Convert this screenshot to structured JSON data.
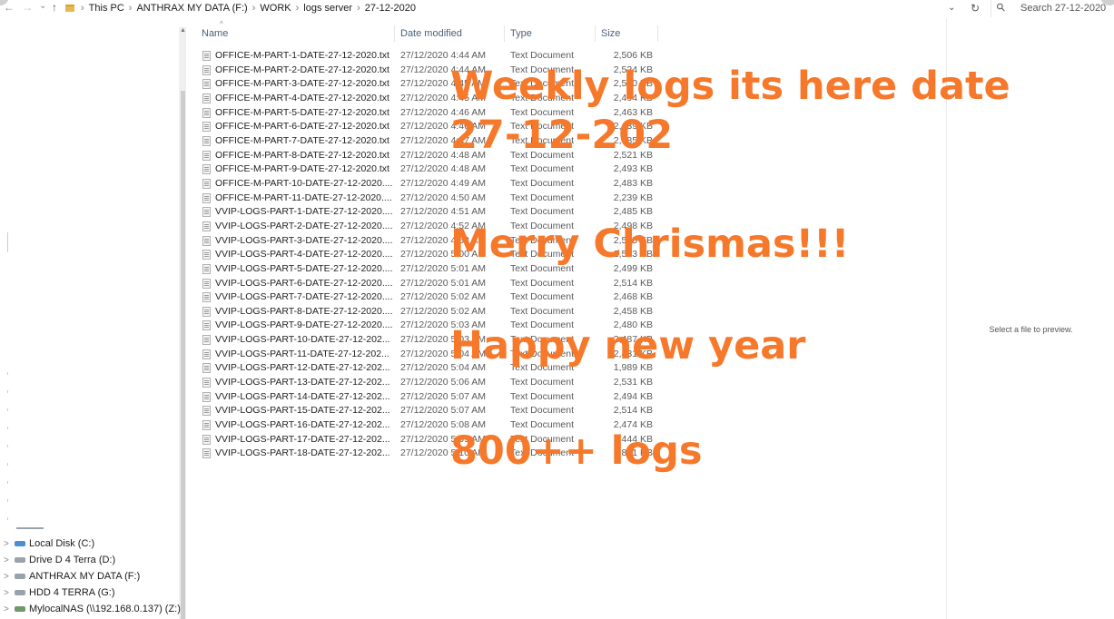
{
  "addressbar": {
    "back": "←",
    "forward": "→",
    "recent": "⌄",
    "up": "↑",
    "crumbs": [
      "This PC",
      "ANTHRAX MY DATA (F:)",
      "WORK",
      "logs server",
      "27-12-2020"
    ],
    "crumb_sep": "›",
    "dropdown": "⌄",
    "refresh": "↻",
    "search_placeholder": "Search 27-12-2020"
  },
  "headers": {
    "sort_indicator": "^",
    "name": "Name",
    "date": "Date modified",
    "type": "Type",
    "size": "Size"
  },
  "files": [
    {
      "name": "OFFICE-M-PART-1-DATE-27-12-2020.txt",
      "date": "27/12/2020 4:44 AM",
      "type": "Text Document",
      "size": "2,506 KB"
    },
    {
      "name": "OFFICE-M-PART-2-DATE-27-12-2020.txt",
      "date": "27/12/2020 4:44 AM",
      "type": "Text Document",
      "size": "2,524 KB"
    },
    {
      "name": "OFFICE-M-PART-3-DATE-27-12-2020.txt",
      "date": "27/12/2020 4:45 AM",
      "type": "Text Document",
      "size": "2,520 KB"
    },
    {
      "name": "OFFICE-M-PART-4-DATE-27-12-2020.txt",
      "date": "27/12/2020 4:45 AM",
      "type": "Text Document",
      "size": "2,494 KB"
    },
    {
      "name": "OFFICE-M-PART-5-DATE-27-12-2020.txt",
      "date": "27/12/2020 4:46 AM",
      "type": "Text Document",
      "size": "2,463 KB"
    },
    {
      "name": "OFFICE-M-PART-6-DATE-27-12-2020.txt",
      "date": "27/12/2020 4:46 AM",
      "type": "Text Document",
      "size": "2,439 KB"
    },
    {
      "name": "OFFICE-M-PART-7-DATE-27-12-2020.txt",
      "date": "27/12/2020 4:47 AM",
      "type": "Text Document",
      "size": "2,485 KB"
    },
    {
      "name": "OFFICE-M-PART-8-DATE-27-12-2020.txt",
      "date": "27/12/2020 4:48 AM",
      "type": "Text Document",
      "size": "2,521 KB"
    },
    {
      "name": "OFFICE-M-PART-9-DATE-27-12-2020.txt",
      "date": "27/12/2020 4:48 AM",
      "type": "Text Document",
      "size": "2,493 KB"
    },
    {
      "name": "OFFICE-M-PART-10-DATE-27-12-2020....",
      "date": "27/12/2020 4:49 AM",
      "type": "Text Document",
      "size": "2,483 KB"
    },
    {
      "name": "OFFICE-M-PART-11-DATE-27-12-2020....",
      "date": "27/12/2020 4:50 AM",
      "type": "Text Document",
      "size": "2,239 KB"
    },
    {
      "name": "VVIP-LOGS-PART-1-DATE-27-12-2020....",
      "date": "27/12/2020 4:51 AM",
      "type": "Text Document",
      "size": "2,485 KB"
    },
    {
      "name": "VVIP-LOGS-PART-2-DATE-27-12-2020....",
      "date": "27/12/2020 4:52 AM",
      "type": "Text Document",
      "size": "2,498 KB"
    },
    {
      "name": "VVIP-LOGS-PART-3-DATE-27-12-2020....",
      "date": "27/12/2020 4:53 AM",
      "type": "Text Document",
      "size": "2,515 KB"
    },
    {
      "name": "VVIP-LOGS-PART-4-DATE-27-12-2020....",
      "date": "27/12/2020 5:00 AM",
      "type": "Text Document",
      "size": "2,533 KB"
    },
    {
      "name": "VVIP-LOGS-PART-5-DATE-27-12-2020....",
      "date": "27/12/2020 5:01 AM",
      "type": "Text Document",
      "size": "2,499 KB"
    },
    {
      "name": "VVIP-LOGS-PART-6-DATE-27-12-2020....",
      "date": "27/12/2020 5:01 AM",
      "type": "Text Document",
      "size": "2,514 KB"
    },
    {
      "name": "VVIP-LOGS-PART-7-DATE-27-12-2020....",
      "date": "27/12/2020 5:02 AM",
      "type": "Text Document",
      "size": "2,468 KB"
    },
    {
      "name": "VVIP-LOGS-PART-8-DATE-27-12-2020....",
      "date": "27/12/2020 5:02 AM",
      "type": "Text Document",
      "size": "2,458 KB"
    },
    {
      "name": "VVIP-LOGS-PART-9-DATE-27-12-2020....",
      "date": "27/12/2020 5:03 AM",
      "type": "Text Document",
      "size": "2,480 KB"
    },
    {
      "name": "VVIP-LOGS-PART-10-DATE-27-12-202...",
      "date": "27/12/2020 5:03 AM",
      "type": "Text Document",
      "size": "2,487 KB"
    },
    {
      "name": "VVIP-LOGS-PART-11-DATE-27-12-202...",
      "date": "27/12/2020 5:04 AM",
      "type": "Text Document",
      "size": "2,431 KB"
    },
    {
      "name": "VVIP-LOGS-PART-12-DATE-27-12-202...",
      "date": "27/12/2020 5:04 AM",
      "type": "Text Document",
      "size": "1,989 KB"
    },
    {
      "name": "VVIP-LOGS-PART-13-DATE-27-12-202...",
      "date": "27/12/2020 5:06 AM",
      "type": "Text Document",
      "size": "2,531 KB"
    },
    {
      "name": "VVIP-LOGS-PART-14-DATE-27-12-202...",
      "date": "27/12/2020 5:07 AM",
      "type": "Text Document",
      "size": "2,494 KB"
    },
    {
      "name": "VVIP-LOGS-PART-15-DATE-27-12-202...",
      "date": "27/12/2020 5:07 AM",
      "type": "Text Document",
      "size": "2,514 KB"
    },
    {
      "name": "VVIP-LOGS-PART-16-DATE-27-12-202...",
      "date": "27/12/2020 5:08 AM",
      "type": "Text Document",
      "size": "2,474 KB"
    },
    {
      "name": "VVIP-LOGS-PART-17-DATE-27-12-202...",
      "date": "27/12/2020 5:09 AM",
      "type": "Text Document",
      "size": "2,444 KB"
    },
    {
      "name": "VVIP-LOGS-PART-18-DATE-27-12-202...",
      "date": "27/12/2020 5:10 AM",
      "type": "Text Document",
      "size": "881 KB"
    }
  ],
  "drives": [
    {
      "label": "Local Disk (C:)",
      "icon": "local-disk-icon"
    },
    {
      "label": "Drive D 4 Terra (D:)",
      "icon": "drive-icon"
    },
    {
      "label": "ANTHRAX MY DATA (F:)",
      "icon": "drive-icon"
    },
    {
      "label": "HDD 4 TERRA (G:)",
      "icon": "drive-icon"
    },
    {
      "label": "MylocalNAS (\\\\192.168.0.137) (Z:)",
      "icon": "network-drive-icon"
    }
  ],
  "drive_chevron": ">",
  "preview": {
    "text": "Select a file to preview."
  },
  "overlay": {
    "line1": "Weekly logs its here date",
    "line2": "27-12-202",
    "line3": "Merry Chrismas!!!",
    "line4": "Happy new year",
    "line5": "800++ logs",
    "color": "#f6782a"
  }
}
